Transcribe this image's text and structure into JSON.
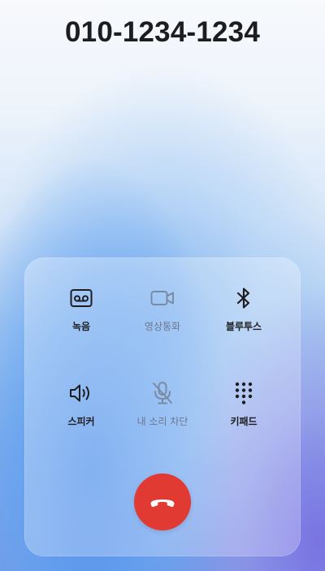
{
  "call": {
    "number": "010-1234-1234"
  },
  "controls": [
    {
      "label": "녹음",
      "icon": "voicemail-icon",
      "enabled": true
    },
    {
      "label": "영상통화",
      "icon": "video-camera-icon",
      "enabled": false
    },
    {
      "label": "블루투스",
      "icon": "bluetooth-icon",
      "enabled": true
    },
    {
      "label": "스피커",
      "icon": "speaker-icon",
      "enabled": true
    },
    {
      "label": "내 소리 차단",
      "icon": "mic-off-icon",
      "enabled": false
    },
    {
      "label": "키패드",
      "icon": "keypad-icon",
      "enabled": true
    }
  ],
  "end_call": {
    "icon": "phone-hangup-icon",
    "color": "#e13a32"
  },
  "colors": {
    "text_primary": "#1d1d1f",
    "text_disabled": "#6b7890",
    "icon_disabled": "#7a8aa3"
  }
}
